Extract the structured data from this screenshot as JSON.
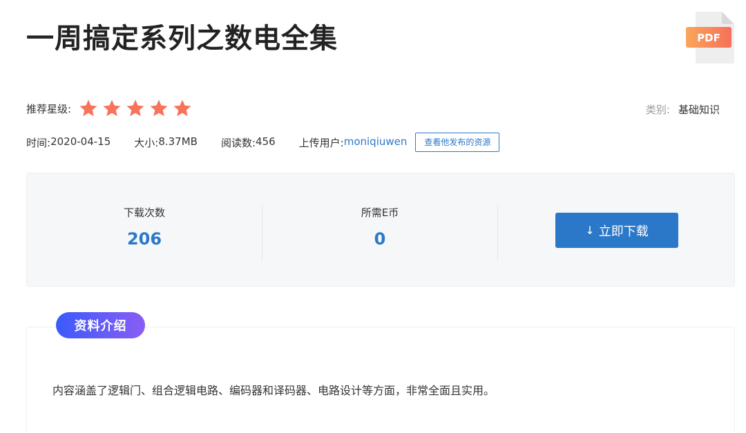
{
  "title": "一周搞定系列之数电全集",
  "file_type_label": "PDF",
  "rating": {
    "label": "推荐星级:",
    "stars": 5,
    "max_stars": 5
  },
  "category": {
    "label": "类别:",
    "value": "基础知识"
  },
  "meta": {
    "time_label": "时间:",
    "time_value": "2020-04-15",
    "size_label": "大小:",
    "size_value": "8.37MB",
    "reads_label": "阅读数:",
    "reads_value": "456",
    "uploader_label": "上传用户:",
    "uploader_value": "moniqiuwen",
    "view_resources_label": "查看他发布的资源"
  },
  "stats": {
    "downloads_label": "下载次数",
    "downloads_value": "206",
    "cost_label": "所需E币",
    "cost_value": "0"
  },
  "download_button": {
    "icon": "arrow-down-icon",
    "label": "立即下载"
  },
  "intro": {
    "tag_label": "资料介绍",
    "text": "内容涵盖了逻辑门、组合逻辑电路、编码器和译码器、电路设计等方面，非常全面且实用。"
  },
  "colors": {
    "accent": "#2b78c9",
    "star": "#f7735c",
    "tag_start": "#3b5bfb",
    "tag_end": "#8a5cf5"
  }
}
